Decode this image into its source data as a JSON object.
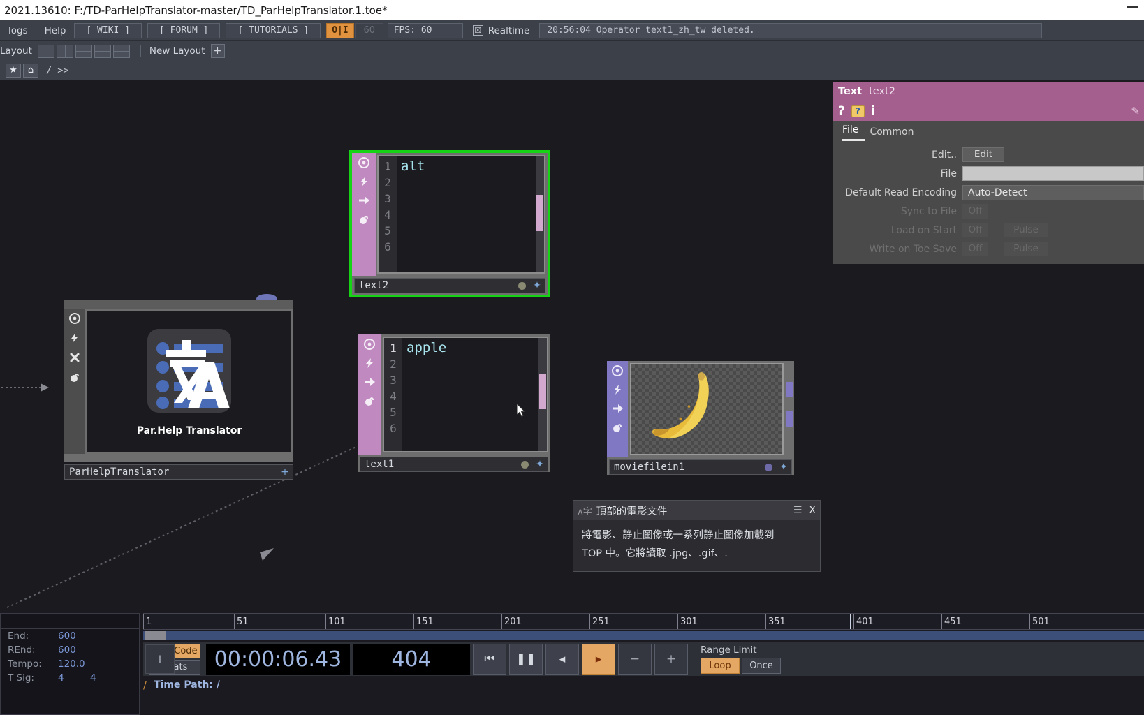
{
  "window": {
    "title": "2021.13610: F:/TD-ParHelpTranslator-master/TD_ParHelpTranslator.1.toe*"
  },
  "menubar": {
    "items": [
      "logs",
      "Help"
    ],
    "buttons": [
      "[ WIKI ]",
      "[ FORUM ]",
      "[ TUTORIALS ]"
    ],
    "oi_toggle": "O|I",
    "cook_rate": "60",
    "fps": "FPS:  60",
    "realtime_label": "Realtime",
    "realtime_checked": "☒",
    "status_message": "20:56:04 Operator text1_zh_tw deleted."
  },
  "layoutbar": {
    "label": "Layout",
    "new_layout": "New Layout",
    "plus": "+"
  },
  "pathbar": {
    "bookmark": "★",
    "home": "⌂",
    "path": "/ >>"
  },
  "parameters": {
    "op_type": "Text",
    "op_name": "text2",
    "icons": {
      "help": "?",
      "helpbook": "help-book",
      "info": "i",
      "pencil": "✎"
    },
    "tabs": [
      {
        "label": "File",
        "active": true
      },
      {
        "label": "Common",
        "active": false
      }
    ],
    "rows": [
      {
        "label": "Edit..",
        "type": "button",
        "value": "Edit",
        "dim": false
      },
      {
        "label": "File",
        "type": "field",
        "value": "",
        "dim": false
      },
      {
        "label": "Default Read Encoding",
        "type": "menu",
        "value": "Auto-Detect",
        "dim": false
      },
      {
        "label": "Sync to File",
        "type": "toggle",
        "value": "Off",
        "dim": true
      },
      {
        "label": "Load on Start",
        "type": "toggle_pulse",
        "value": "Off",
        "pulse": "Pulse",
        "dim": true
      },
      {
        "label": "Write on Toe Save",
        "type": "toggle_pulse",
        "value": "Off",
        "pulse": "Pulse",
        "dim": true
      }
    ]
  },
  "nodes": {
    "parhelptranslator": {
      "name": "ParHelpTranslator",
      "caption": "Par.Help Translator",
      "plus": "+"
    },
    "text2": {
      "name": "text2",
      "selected": true,
      "line_numbers": [
        "1",
        "2",
        "3",
        "4",
        "5",
        "6"
      ],
      "content": "alt"
    },
    "text1": {
      "name": "text1",
      "selected": false,
      "line_numbers": [
        "1",
        "2",
        "3",
        "4",
        "5",
        "6"
      ],
      "content": "apple"
    },
    "moviefilein1": {
      "name": "moviefilein1",
      "selected": false,
      "preview": "banana-image"
    }
  },
  "tooltip": {
    "icon": "A-zi-icon",
    "title": "頂部的電影文件",
    "list_icon": "☰",
    "close_icon": "X",
    "lines": [
      "將電影、静止圖像或一系列静止圖像加載到",
      "TOP 中。它將讀取 .jpg、.gif、."
    ]
  },
  "timeline": {
    "info": [
      {
        "key": "End:",
        "value": "600"
      },
      {
        "key": "REnd:",
        "value": "600"
      },
      {
        "key": "Tempo:",
        "value": "120.0"
      },
      {
        "key": "T Sig:",
        "value": "4",
        "value2": "4"
      }
    ],
    "ruler_ticks": [
      "1",
      "51",
      "101",
      "151",
      "201",
      "251",
      "301",
      "351",
      "401",
      "451",
      "501"
    ],
    "mode_buttons": [
      {
        "label": "TimeCode",
        "active": true
      },
      {
        "label": "Beats",
        "active": false
      }
    ],
    "timecode": "00:00:06.43",
    "frame": "404",
    "transport": [
      {
        "name": "go-to-start-button",
        "glyph": "⏮",
        "active": false
      },
      {
        "name": "pause-button",
        "glyph": "⏸",
        "active": false
      },
      {
        "name": "step-back-button",
        "glyph": "◂",
        "active": false
      },
      {
        "name": "play-button",
        "glyph": "▸",
        "active": true
      },
      {
        "name": "decrement-button",
        "glyph": "−",
        "active": false
      },
      {
        "name": "increment-button",
        "glyph": "+",
        "active": false
      }
    ],
    "range_limit_label": "Range Limit",
    "range_buttons": [
      {
        "label": "Loop",
        "active": true
      },
      {
        "label": "Once",
        "active": false
      }
    ],
    "time_path_label": "Time Path: /",
    "time_path_slash": "/",
    "playhead_marker": "I"
  },
  "colors": {
    "accent_orange": "#e5a864",
    "selection_green": "#16d316",
    "dat_purple": "#c08ac0",
    "top_purple": "#8178c4",
    "param_header": "#a45f8f"
  }
}
